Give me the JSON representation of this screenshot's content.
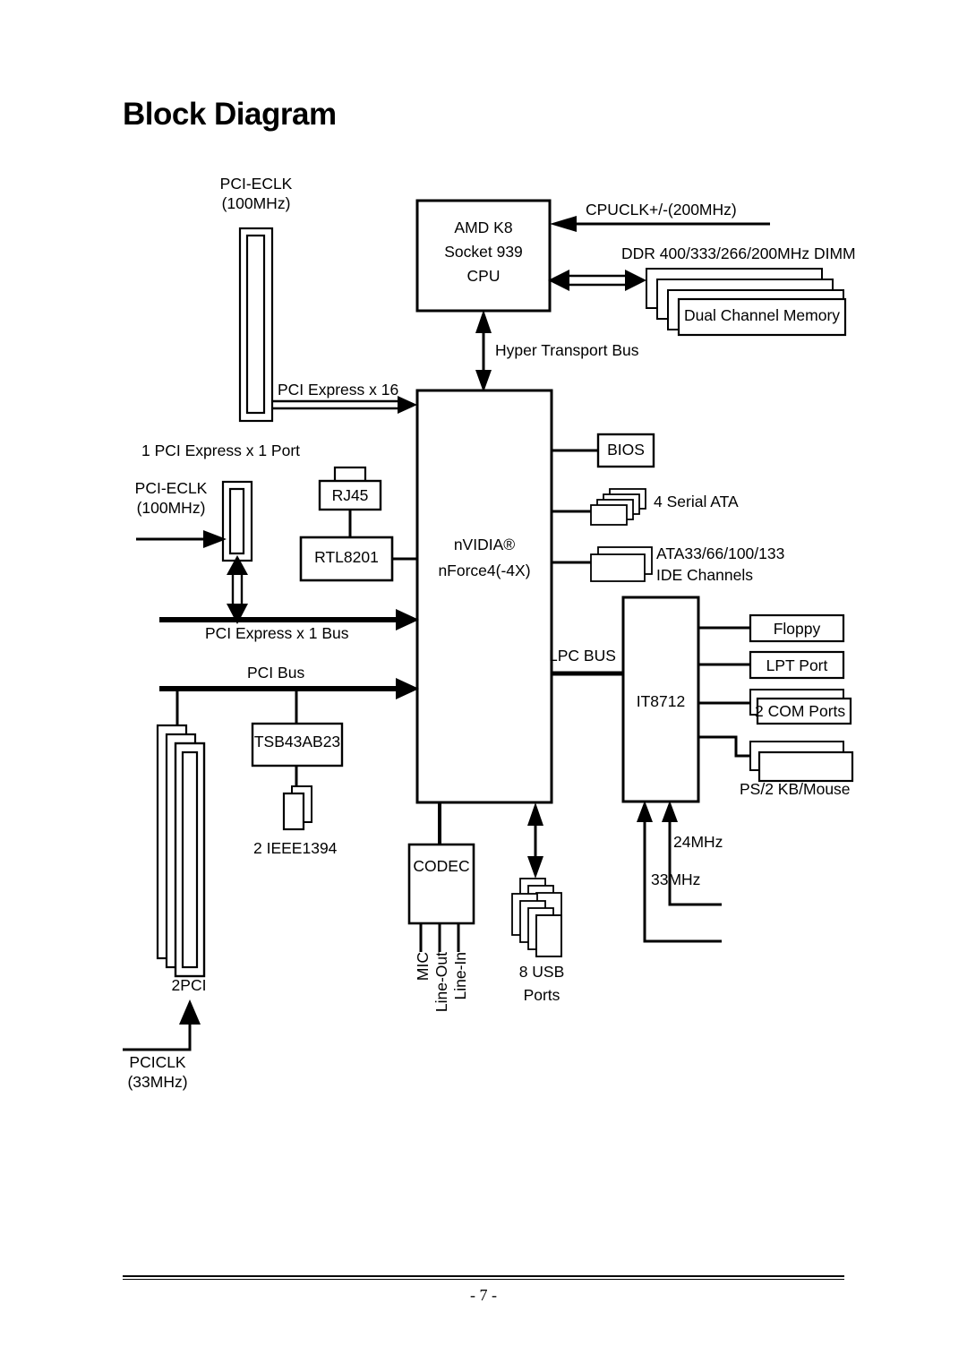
{
  "page": {
    "title": "Block Diagram",
    "page_number": "- 7 -"
  },
  "diagram": {
    "type": "motherboard-block-diagram",
    "blocks": {
      "cpu": {
        "lines": [
          "AMD K8",
          "Socket 939",
          "CPU"
        ]
      },
      "chipset": {
        "line1": "nVIDIA®",
        "line2": "nForce4(-4X)"
      },
      "bios": {
        "label": "BIOS"
      },
      "lan_phy": {
        "label": "RTL8201"
      },
      "rj45": {
        "label": "RJ45"
      },
      "firewire": {
        "label": "TSB43AB23"
      },
      "codec": {
        "label": "CODEC"
      },
      "superio": {
        "label": "IT8712"
      },
      "memory": {
        "label": "Dual Channel Memory"
      },
      "floppy": {
        "label": "Floppy"
      },
      "lpt": {
        "label": "LPT Port"
      },
      "com": {
        "label": "2 COM Ports"
      }
    },
    "labels": {
      "pci_eclk_top": {
        "line1": "PCI-ECLK",
        "line2": "(100MHz)"
      },
      "pci_eclk_mid": {
        "line1": "PCI-ECLK",
        "line2": "(100MHz)"
      },
      "cpuclk": "CPUCLK+/-(200MHz)",
      "ddr": "DDR 400/333/266/200MHz DIMM",
      "hyper_transport": "Hyper Transport Bus",
      "pcie_x16": "PCI Express x 16",
      "pcie_x1_port": "1 PCI Express x 1 Port",
      "pcie_x1_bus": "PCI Express x 1 Bus",
      "pci_bus": "PCI Bus",
      "lpc_bus": "LPC BUS",
      "serial_ata": "4 Serial ATA",
      "ide_line1": "ATA33/66/100/133",
      "ide_line2": "IDE Channels",
      "ps2": "PS/2 KB/Mouse",
      "ieee1394": "2 IEEE1394",
      "pci_slots": "2PCI",
      "pciclk": "PCICLK",
      "pciclk_freq": "(33MHz)",
      "clk_24mhz": "24MHz",
      "clk_33mhz": "33MHz",
      "usb_line1": "8 USB",
      "usb_line2": "Ports",
      "audio_mic": "MIC",
      "audio_lineout": "Line-Out",
      "audio_linein": "Line-In"
    },
    "colors": {
      "stroke": "#000000",
      "fill": "#ffffff",
      "shadow": "#555555"
    }
  }
}
